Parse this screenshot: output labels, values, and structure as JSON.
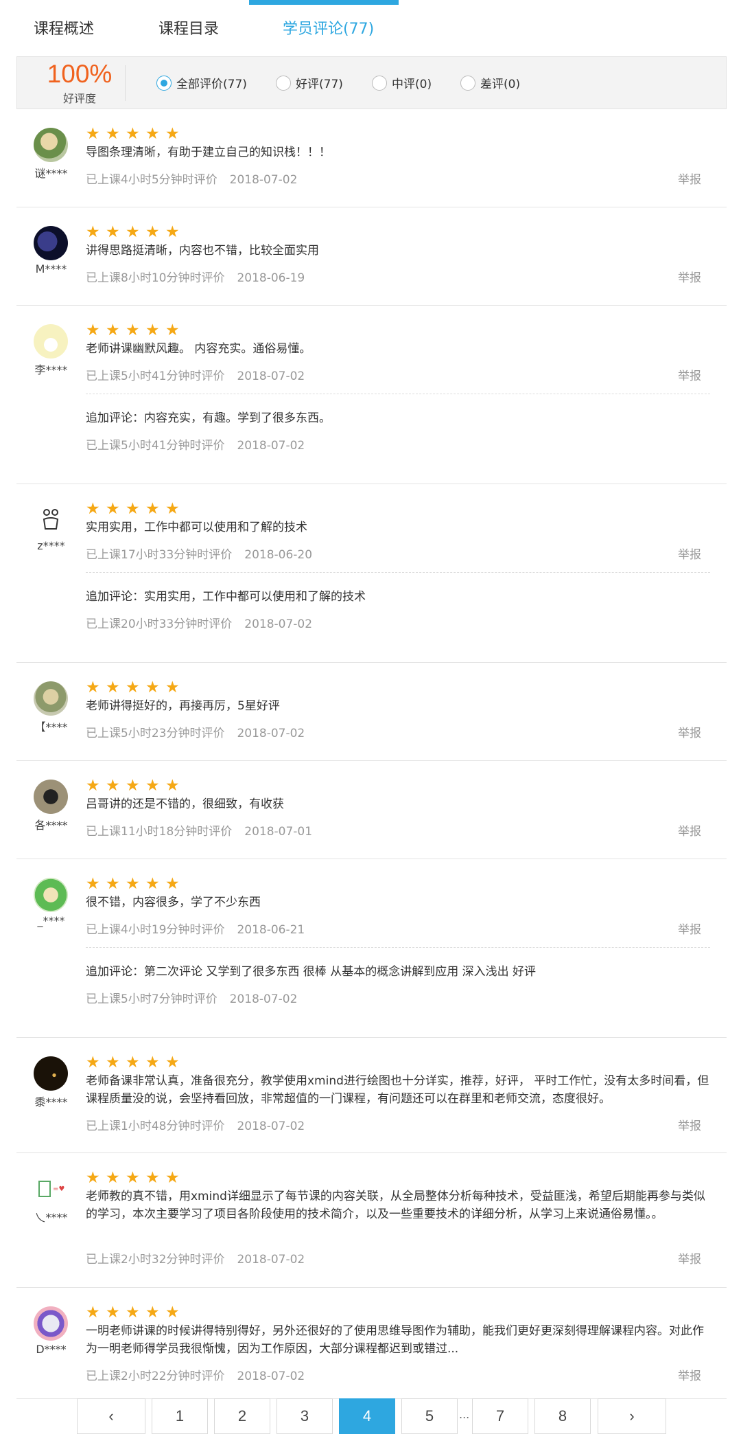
{
  "tabs": [
    {
      "label": "课程概述"
    },
    {
      "label": "课程目录"
    },
    {
      "label": "学员评论(77)"
    }
  ],
  "summary": {
    "percent": "100%",
    "percent_label": "好评度",
    "filters": [
      {
        "label": "全部评价(77)",
        "checked": true
      },
      {
        "label": "好评(77)",
        "checked": false
      },
      {
        "label": "中评(0)",
        "checked": false
      },
      {
        "label": "差评(0)",
        "checked": false
      }
    ]
  },
  "report_label": "举报",
  "star_color": "#f5a815",
  "accent_color": "#2ea7e0",
  "reviews": [
    {
      "user": "谜****",
      "stars": 5,
      "text": "导图条理清晰，有助于建立自己的知识栈！！！",
      "meta": "已上课4小时5分钟时评价",
      "date": "2018-07-02"
    },
    {
      "user": "M****",
      "stars": 5,
      "text": "讲得思路挺清晰，内容也不错，比较全面实用",
      "meta": "已上课8小时10分钟时评价",
      "date": "2018-06-19"
    },
    {
      "user": "李****",
      "stars": 5,
      "text": "老师讲课幽默风趣。 内容充实。通俗易懂。",
      "meta": "已上课5小时41分钟时评价",
      "date": "2018-07-02",
      "followup": {
        "text": "追加评论：内容充实，有趣。学到了很多东西。",
        "meta": "已上课5小时41分钟时评价",
        "date": "2018-07-02"
      }
    },
    {
      "user": "z****",
      "stars": 5,
      "text": "实用实用，工作中都可以使用和了解的技术",
      "meta": "已上课17小时33分钟时评价",
      "date": "2018-06-20",
      "followup": {
        "text": "追加评论：实用实用，工作中都可以使用和了解的技术",
        "meta": "已上课20小时33分钟时评价",
        "date": "2018-07-02"
      }
    },
    {
      "user": "【****",
      "stars": 5,
      "text": "老师讲得挺好的，再接再厉，5星好评",
      "meta": "已上课5小时23分钟时评价",
      "date": "2018-07-02"
    },
    {
      "user": "各****",
      "stars": 5,
      "text": "吕哥讲的还是不错的，很细致，有收获",
      "meta": "已上课11小时18分钟时评价",
      "date": "2018-07-01"
    },
    {
      "user": "_****",
      "stars": 5,
      "text": "很不错，内容很多，学了不少东西",
      "meta": "已上课4小时19分钟时评价",
      "date": "2018-06-21",
      "followup": {
        "text": "追加评论：第二次评论 又学到了很多东西 很棒 从基本的概念讲解到应用 深入浅出 好评",
        "meta": "已上课5小时7分钟时评价",
        "date": "2018-07-02"
      }
    },
    {
      "user": "黍****",
      "stars": 5,
      "text": "老师备课非常认真，准备很充分，教学使用xmind进行绘图也十分详实，推荐，好评，  平时工作忙，没有太多时间看，但课程质量没的说，会坚持看回放，非常超值的一门课程，有问题还可以在群里和老师交流，态度很好。",
      "meta": "已上课1小时48分钟时评价",
      "date": "2018-07-02"
    },
    {
      "user": "乀****",
      "stars": 5,
      "text": "老师教的真不错，用xmind详细显示了每节课的内容关联，从全局整体分析每种技术，受益匪浅，希望后期能再参与类似的学习，本次主要学习了项目各阶段使用的技术简介，以及一些重要技术的详细分析，从学习上来说通俗易懂。。",
      "meta": "已上课2小时32分钟时评价",
      "date": "2018-07-02"
    },
    {
      "user": "D****",
      "stars": 5,
      "text": "一明老师讲课的时候讲得特别得好，另外还很好的了使用思维导图作为辅助，能我们更好更深刻得理解课程内容。对此作为一明老师得学员我很惭愧，因为工作原因，大部分课程都迟到或错过...",
      "meta": "已上课2小时22分钟时评价",
      "date": "2018-07-02"
    }
  ],
  "pagination": {
    "prev": "‹",
    "next": "›",
    "pages": [
      "1",
      "2",
      "3",
      "4",
      "5",
      "7",
      "8"
    ],
    "current": "4",
    "ellipsis": "..."
  }
}
